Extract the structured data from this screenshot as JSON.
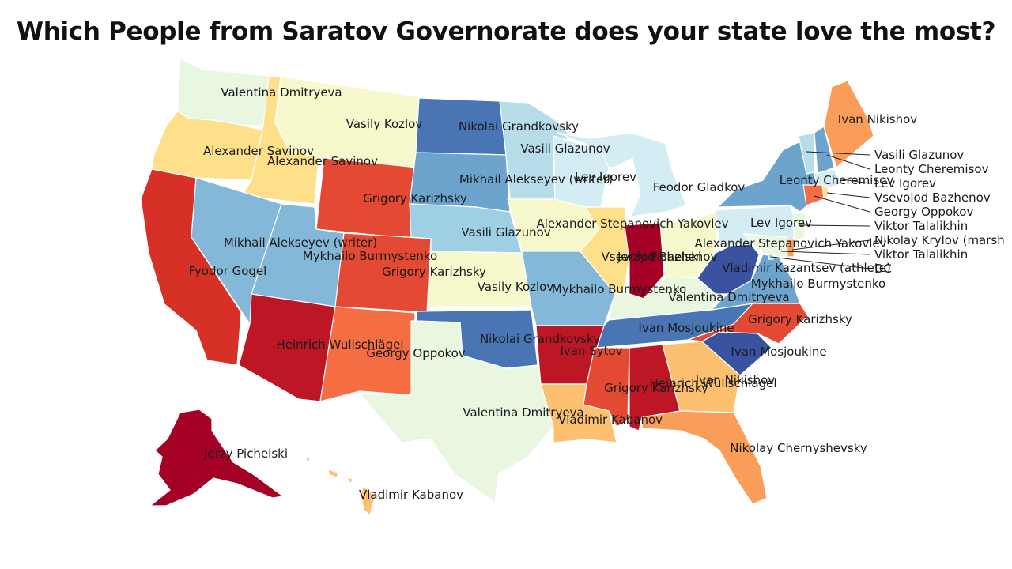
{
  "title": "Which People from Saratov Governorate does your state love the most?",
  "colors": {
    "c1": "#a50026",
    "c2": "#bd1726",
    "c3": "#d73027",
    "c4": "#e34933",
    "c5": "#f46d43",
    "c6": "#f99d59",
    "c7": "#fdc070",
    "c8": "#fee08b",
    "c9": "#f7f8cb",
    "c10": "#e9f6e0",
    "c11": "#d4ecf3",
    "c12": "#b7ddeb",
    "c13": "#9ecfe3",
    "c14": "#84b8d8",
    "c15": "#6ca4cd",
    "c16": "#5d8ec4",
    "c17": "#4a75b5",
    "c18": "#3a53a0"
  },
  "states": [
    {
      "id": "WA",
      "person": "Valentina Dmitryeva",
      "color": "c10"
    },
    {
      "id": "OR",
      "person": "Alexander Savinov",
      "color": "c8"
    },
    {
      "id": "CA",
      "person": "",
      "color": "c3"
    },
    {
      "id": "ID",
      "person": "Alexander Savinov",
      "color": "c8"
    },
    {
      "id": "NV",
      "person": "Fyodor Gogel",
      "color": "c14"
    },
    {
      "id": "MT",
      "person": "Vasily Kozlov",
      "color": "c9"
    },
    {
      "id": "WY",
      "person": "Grigory Karizhsky",
      "color": "c4"
    },
    {
      "id": "UT",
      "person": "Mikhail Alekseyev (writer)",
      "color": "c14"
    },
    {
      "id": "CO",
      "person": "Grigory Karizhsky",
      "color": "c4"
    },
    {
      "id": "AZ",
      "person": "Heinrich Wullschlägel",
      "color": "c2"
    },
    {
      "id": "NM",
      "person": "Georgy Oppokov",
      "color": "c5"
    },
    {
      "id": "ND",
      "person": "Nikolai Grandkovsky",
      "color": "c17"
    },
    {
      "id": "SD",
      "person": "Mikhail Alekseyev (writer)",
      "color": "c15"
    },
    {
      "id": "NE",
      "person": "Vasili Glazunov",
      "color": "c13"
    },
    {
      "id": "KS",
      "person": "Vasily Kozlov",
      "color": "c9"
    },
    {
      "id": "OK",
      "person": "Nikolai Grandkovsky",
      "color": "c17"
    },
    {
      "id": "TX",
      "person": "Valentina Dmitryeva",
      "color": "c10"
    },
    {
      "id": "MN",
      "person": "Vasili Glazunov",
      "color": "c12"
    },
    {
      "id": "IA",
      "person": "Alexander Stepanovich Yakovlev",
      "color": "c9"
    },
    {
      "id": "MO",
      "person": "Mykhailo Burmystenko",
      "color": "c14"
    },
    {
      "id": "AR",
      "person": "Ivan Sytov",
      "color": "c2"
    },
    {
      "id": "LA",
      "person": "Vladimir Kabanov",
      "color": "c7"
    },
    {
      "id": "WI",
      "person": "Lev Igorev",
      "color": "c11"
    },
    {
      "id": "IL",
      "person": "Vsevolod Bazhenov",
      "color": "c8"
    },
    {
      "id": "MI",
      "person": "Feodor Gladkov",
      "color": "c11"
    },
    {
      "id": "IN",
      "person": "Jerzy Pichelski",
      "color": "c1"
    },
    {
      "id": "OH",
      "person": "Alexander Stepanovich Yakovlev",
      "color": "c9"
    },
    {
      "id": "KY",
      "person": "Valentina Dmitryeva",
      "color": "c10"
    },
    {
      "id": "TN",
      "person": "Ivan Mosjoukine",
      "color": "c17"
    },
    {
      "id": "MS",
      "person": "Grigory Karizhsky",
      "color": "c4"
    },
    {
      "id": "AL",
      "person": "Heinrich Wullschlägel",
      "color": "c2"
    },
    {
      "id": "GA",
      "person": "Ivan Nikishov",
      "color": "c7"
    },
    {
      "id": "FL",
      "person": "Nikolay Chernyshevsky",
      "color": "c6"
    },
    {
      "id": "SC",
      "person": "Ivan Mosjoukine",
      "color": "c18"
    },
    {
      "id": "NC",
      "person": "Grigory Karizhsky",
      "color": "c4"
    },
    {
      "id": "VA",
      "person": "Mykhailo Burmystenko",
      "color": "c15"
    },
    {
      "id": "WV",
      "person": "Vladimir Kazantsev (athlete)",
      "color": "c18"
    },
    {
      "id": "PA",
      "person": "Lev Igorev",
      "color": "c11"
    },
    {
      "id": "NY",
      "person": "Leonty Cheremisov",
      "color": "c15"
    },
    {
      "id": "VT",
      "person": "Vasili Glazunov",
      "color": "c12"
    },
    {
      "id": "NH",
      "person": "Leonty Cheremisov",
      "color": "c15"
    },
    {
      "id": "ME",
      "person": "Ivan Nikishov",
      "color": "c6"
    },
    {
      "id": "MA",
      "person": "Lev Igorev",
      "color": "c11"
    },
    {
      "id": "RI",
      "person": "Vsevolod Bazhenov",
      "color": "c8"
    },
    {
      "id": "CT",
      "person": "Georgy Oppokov",
      "color": "c5"
    },
    {
      "id": "NJ",
      "person": "Viktor Talalikhin",
      "color": "c10"
    },
    {
      "id": "DE",
      "person": "Nikolay Krylov (marshal)",
      "color": "c6"
    },
    {
      "id": "MD",
      "person": "Viktor Talalikhin",
      "color": "c10"
    },
    {
      "id": "DC",
      "person": "DC",
      "color": "c13"
    },
    {
      "id": "AK",
      "person": "Jerzy Pichelski",
      "color": "c1"
    },
    {
      "id": "HI",
      "person": "Vladimir Kabanov",
      "color": "c7"
    }
  ],
  "map_labels": [
    {
      "id": "WA",
      "text": "Valentina Dmitryeva"
    },
    {
      "id": "MT",
      "text": "Vasily Kozlov"
    },
    {
      "id": "ND",
      "text": "Nikolai Grandkovsky"
    },
    {
      "id": "ME",
      "text": "Ivan Nikishov"
    },
    {
      "id": "MN",
      "text": "Vasili Glazunov"
    },
    {
      "id": "OR",
      "text": "Alexander Savinov"
    },
    {
      "id": "ID",
      "text": "Alexander Savinov"
    },
    {
      "id": "WI",
      "text": "Lev Igorev"
    },
    {
      "id": "SD",
      "text": "Mikhail Alekseyev (writer)"
    },
    {
      "id": "MI",
      "text": "Feodor Gladkov"
    },
    {
      "id": "NY",
      "text": "Leonty Cheremisov"
    },
    {
      "id": "WY",
      "text": "Grigory Karizhsky"
    },
    {
      "id": "IA",
      "text": "Alexander Stepanovich Yakovlev"
    },
    {
      "id": "PA",
      "text": "Lev Igorev"
    },
    {
      "id": "NE",
      "text": "Vasili Glazunov"
    },
    {
      "id": "UT",
      "text": "Mikhail Alekseyev (writer)"
    },
    {
      "id": "OH",
      "text": "Alexander Stepanovich Yakovlev"
    },
    {
      "id": "UT2",
      "text": "Mykhailo Burmystenko"
    },
    {
      "id": "IL",
      "text": "Vsevolod Bazhenov"
    },
    {
      "id": "IN",
      "text": "Jerzy Pichelski"
    },
    {
      "id": "NV",
      "text": "Fyodor Gogel"
    },
    {
      "id": "CO",
      "text": "Grigory Karizhsky"
    },
    {
      "id": "WV",
      "text": "Vladimir Kazantsev (athlete)"
    },
    {
      "id": "VA",
      "text": "Mykhailo Burmystenko"
    },
    {
      "id": "KS",
      "text": "Vasily Kozlov"
    },
    {
      "id": "MO",
      "text": "Mykhailo Burmystenko"
    },
    {
      "id": "KY",
      "text": "Valentina Dmitryeva"
    },
    {
      "id": "NC",
      "text": "Grigory Karizhsky"
    },
    {
      "id": "TN",
      "text": "Ivan Mosjoukine"
    },
    {
      "id": "OK",
      "text": "Nikolai Grandkovsky"
    },
    {
      "id": "AZ",
      "text": "Heinrich Wullschlägel"
    },
    {
      "id": "AR",
      "text": "Ivan Sytov"
    },
    {
      "id": "NM",
      "text": "Georgy Oppokov"
    },
    {
      "id": "SC",
      "text": "Ivan Mosjoukine"
    },
    {
      "id": "GA",
      "text": "Ivan Nikishov"
    },
    {
      "id": "AL",
      "text": "Heinrich Wullschlägel"
    },
    {
      "id": "MS",
      "text": "Grigory Karizhsky"
    },
    {
      "id": "TX",
      "text": "Valentina Dmitryeva"
    },
    {
      "id": "LA",
      "text": "Vladimir Kabanov"
    },
    {
      "id": "FL",
      "text": "Nikolay Chernyshevsky"
    },
    {
      "id": "AK",
      "text": "Jerzy Pichelski"
    },
    {
      "id": "HI",
      "text": "Vladimir Kabanov"
    }
  ],
  "callouts": [
    {
      "id": "VT",
      "text": "Vasili Glazunov"
    },
    {
      "id": "NH",
      "text": "Leonty Cheremisov"
    },
    {
      "id": "MA",
      "text": "Lev Igorev"
    },
    {
      "id": "RI",
      "text": "Vsevolod Bazhenov"
    },
    {
      "id": "CT",
      "text": "Georgy Oppokov"
    },
    {
      "id": "NJ",
      "text": "Viktor Talalikhin"
    },
    {
      "id": "DE",
      "text": "Nikolay Krylov (marsh"
    },
    {
      "id": "MD",
      "text": "Viktor Talalikhin"
    },
    {
      "id": "DC",
      "text": "DC"
    }
  ]
}
